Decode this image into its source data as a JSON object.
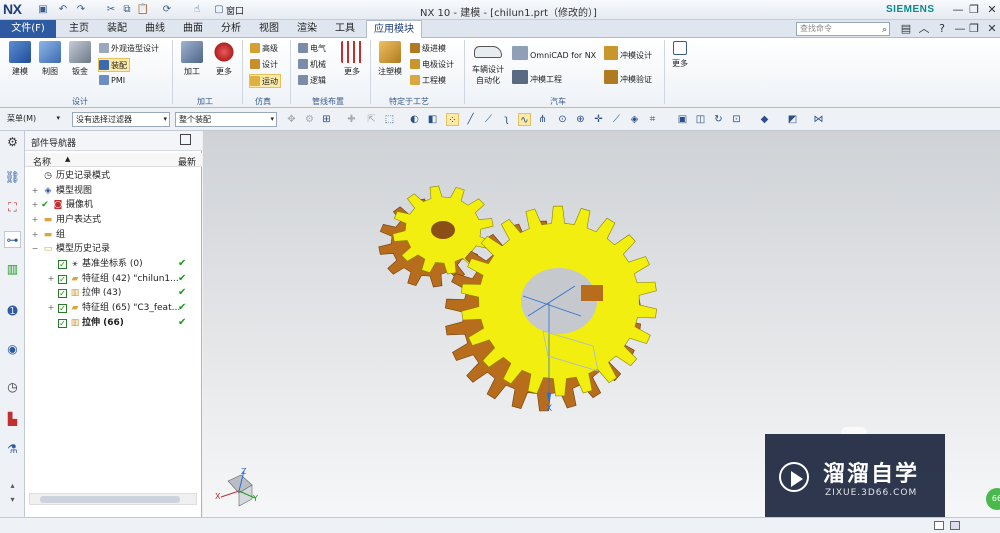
{
  "app": {
    "logo": "NX",
    "title": "NX 10 - 建模 - [chilun1.prt（修改的）]",
    "brand": "SIEMENS",
    "window_menu": "窗口"
  },
  "menu": {
    "file": "文件(F)",
    "tabs": [
      "主页",
      "装配",
      "曲线",
      "曲面",
      "分析",
      "视图",
      "渲染",
      "工具",
      "应用模块"
    ],
    "active_tab": "应用模块",
    "search_placeholder": "查找命令"
  },
  "ribbon": {
    "design_group": {
      "label": "设计",
      "big": [
        "建模",
        "制图",
        "钣金"
      ],
      "small": [
        "外观造型设计",
        "装配",
        "PMI"
      ]
    },
    "machining_group": {
      "label": "加工",
      "big": [
        "加工",
        "更多"
      ]
    },
    "simulation_group": {
      "label": "仿真",
      "small": [
        "高级",
        "设计",
        "运动"
      ]
    },
    "routing_group": {
      "label": "管线布置",
      "small": [
        "电气",
        "机械",
        "逻辑"
      ],
      "more": "更多"
    },
    "process_group": {
      "label": "特定于工艺",
      "big": [
        "注塑模"
      ],
      "small": [
        "级进模",
        "电极设计",
        "工程模"
      ]
    },
    "auto_group": {
      "label": "汽车",
      "vehicle": [
        "车辆设计",
        "自动化"
      ],
      "small": [
        "OmniCAD for NX",
        "冲模工程",
        "冲模设计",
        "冲模验证"
      ]
    },
    "more": "更多"
  },
  "toolbar": {
    "menu": "菜单(M)",
    "filter": "没有选择过滤器",
    "scope": "整个装配"
  },
  "navigator": {
    "title": "部件导航器",
    "col_name": "名称",
    "col_latest": "最新",
    "rows": [
      "历史记录模式",
      "模型视图",
      "摄像机",
      "用户表达式",
      "组",
      "模型历史记录",
      "基准坐标系 (0)",
      "特征组 (42) \"chilun1...",
      "拉伸 (43)",
      "特征组 (65) \"C3_feat...",
      "拉伸 (66)"
    ]
  },
  "viewport": {
    "axis_x": "X",
    "triad": [
      "Z",
      "Y",
      "X"
    ]
  },
  "watermark": {
    "name": "溜溜自学",
    "url": "ZIXUE.3D66.COM",
    "badge": "66"
  },
  "colors": {
    "gear_face": "#f2ee10",
    "gear_side": "#b86d1c",
    "accent": "#2d5aa0"
  }
}
